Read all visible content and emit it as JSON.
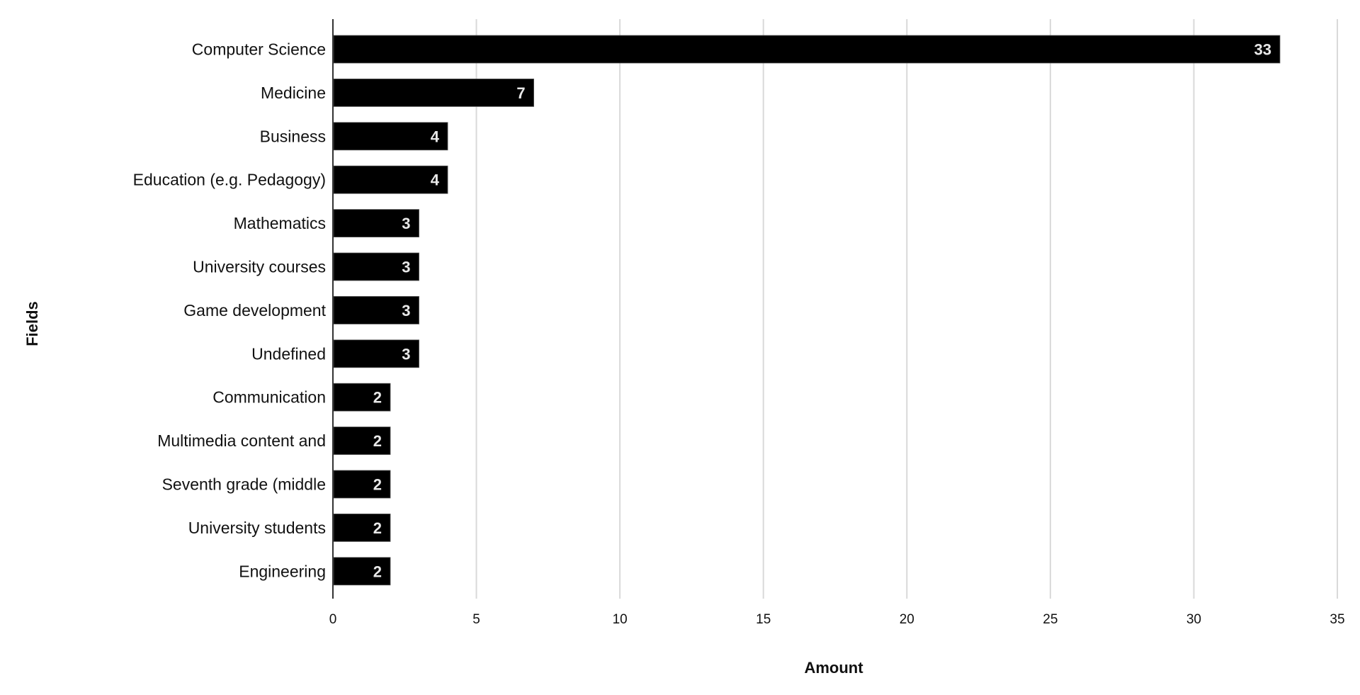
{
  "chart_data": {
    "type": "bar",
    "orientation": "horizontal",
    "title": "",
    "xlabel": "Amount",
    "ylabel": "Fields",
    "categories": [
      "Computer Science",
      "Medicine",
      "Business",
      "Education (e.g. Pedagogy)",
      "Mathematics",
      "University   courses",
      "Game development",
      "Undefined",
      "Communication",
      "Multimedia content and",
      "Seventh grade (middle",
      "University students",
      "Engineering"
    ],
    "values": [
      33,
      7,
      4,
      4,
      3,
      3,
      3,
      3,
      2,
      2,
      2,
      2,
      2
    ],
    "data_labels": [
      "33",
      "7",
      "4",
      "4",
      "3",
      "3",
      "3",
      "3",
      "2",
      "2",
      "2",
      "2",
      "2"
    ],
    "xlim": [
      0,
      35
    ],
    "xticks": [
      0,
      5,
      10,
      15,
      20,
      25,
      30,
      35
    ],
    "xtick_labels": [
      "0",
      "5",
      "10",
      "15",
      "20",
      "25",
      "30",
      "35"
    ],
    "grid": "vertical",
    "legend": "none",
    "colors": {
      "bar": "#000000",
      "grid": "#d9d9d9",
      "axis": "#333333",
      "bar_label": "#e8e8e8"
    }
  }
}
